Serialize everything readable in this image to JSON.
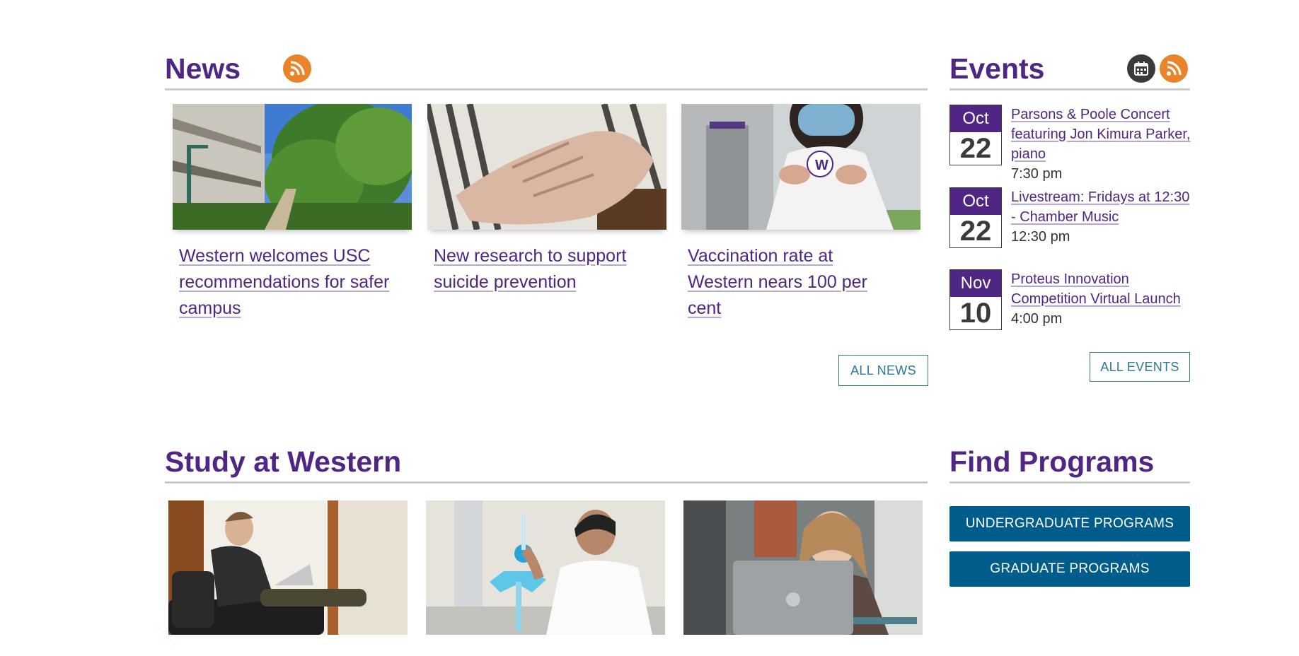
{
  "news": {
    "title": "News",
    "rss_icon": "rss-icon",
    "cards": [
      {
        "headline": "Western welcomes USC recommendations for safer campus",
        "image": "campus-trees-photo"
      },
      {
        "headline": "New research to support suicide prevention",
        "image": "elderly-hands-photo"
      },
      {
        "headline": "Vaccination rate at Western nears 100 per cent",
        "image": "masked-student-photo"
      }
    ],
    "all_label": "ALL NEWS"
  },
  "events": {
    "title": "Events",
    "calendar_icon": "calendar-icon",
    "rss_icon": "rss-icon",
    "items": [
      {
        "month": "Oct",
        "day": "22",
        "title": "Parsons & Poole Concert featuring Jon Kimura Parker, piano",
        "time": "7:30 pm"
      },
      {
        "month": "Oct",
        "day": "22",
        "title": "Livestream: Fridays at 12:30 - Chamber Music",
        "time": "12:30 pm"
      },
      {
        "month": "Nov",
        "day": "10",
        "title": "Proteus Innovation Competition Virtual Launch",
        "time": "4:00 pm"
      }
    ],
    "all_label": "ALL EVENTS"
  },
  "study": {
    "title": "Study at Western",
    "cards": [
      {
        "image": "student-laptop-photo"
      },
      {
        "image": "student-lab-photo"
      },
      {
        "image": "student-smiling-laptop-photo"
      }
    ]
  },
  "programs": {
    "title": "Find Programs",
    "undergrad_label": "UNDERGRADUATE PROGRAMS",
    "grad_label": "GRADUATE PROGRAMS"
  },
  "colors": {
    "purple": "#4f2683",
    "rss_orange": "#e9842a",
    "button_blue": "#005d8b",
    "outline_blue": "#2b7a99"
  }
}
